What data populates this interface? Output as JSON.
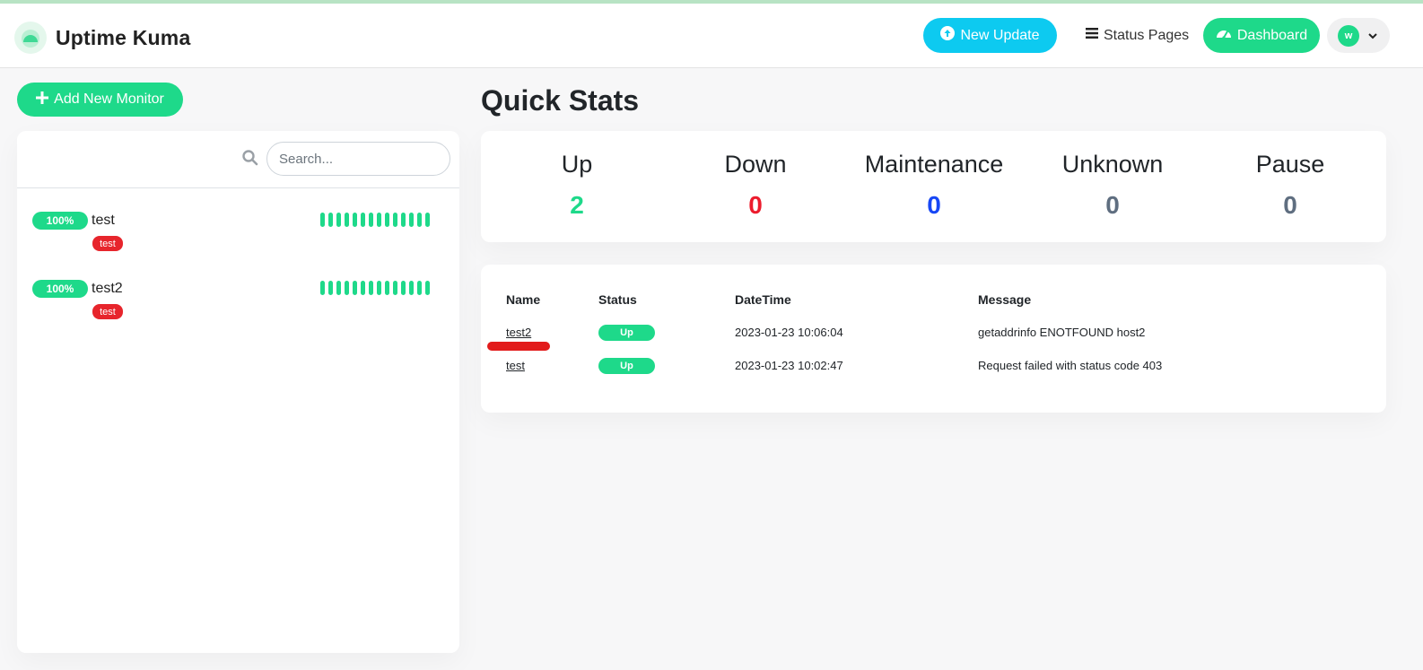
{
  "header": {
    "brand_title": "Uptime Kuma",
    "new_update_label": "New Update",
    "status_pages_label": "Status Pages",
    "dashboard_label": "Dashboard",
    "avatar_initial": "w"
  },
  "sidebar": {
    "add_monitor_label": "Add New Monitor",
    "search_placeholder": "Search...",
    "monitors": [
      {
        "uptime": "100%",
        "name": "test",
        "tag": "test",
        "beats_up": 14
      },
      {
        "uptime": "100%",
        "name": "test2",
        "tag": "test",
        "beats_up": 14
      }
    ]
  },
  "quick_stats": {
    "title": "Quick Stats",
    "items": [
      {
        "label": "Up",
        "value": "2",
        "color": "#1ed98a"
      },
      {
        "label": "Down",
        "value": "0",
        "color": "#ec1c2d"
      },
      {
        "label": "Maintenance",
        "value": "0",
        "color": "#1747f5"
      },
      {
        "label": "Unknown",
        "value": "0",
        "color": "#5f6e80"
      },
      {
        "label": "Pause",
        "value": "0",
        "color": "#5f6e80"
      }
    ]
  },
  "events": {
    "headers": {
      "name": "Name",
      "status": "Status",
      "datetime": "DateTime",
      "message": "Message"
    },
    "rows": [
      {
        "name": "test2",
        "status": "Up",
        "datetime": "2023-01-23 10:06:04",
        "message": "getaddrinfo ENOTFOUND host2"
      },
      {
        "name": "test",
        "status": "Up",
        "datetime": "2023-01-23 10:02:47",
        "message": "Request failed with status code 403"
      }
    ]
  },
  "colors": {
    "brand_green": "#1ed98a",
    "info_cyan": "#0dcaf0",
    "tag_red": "#e7252c"
  }
}
